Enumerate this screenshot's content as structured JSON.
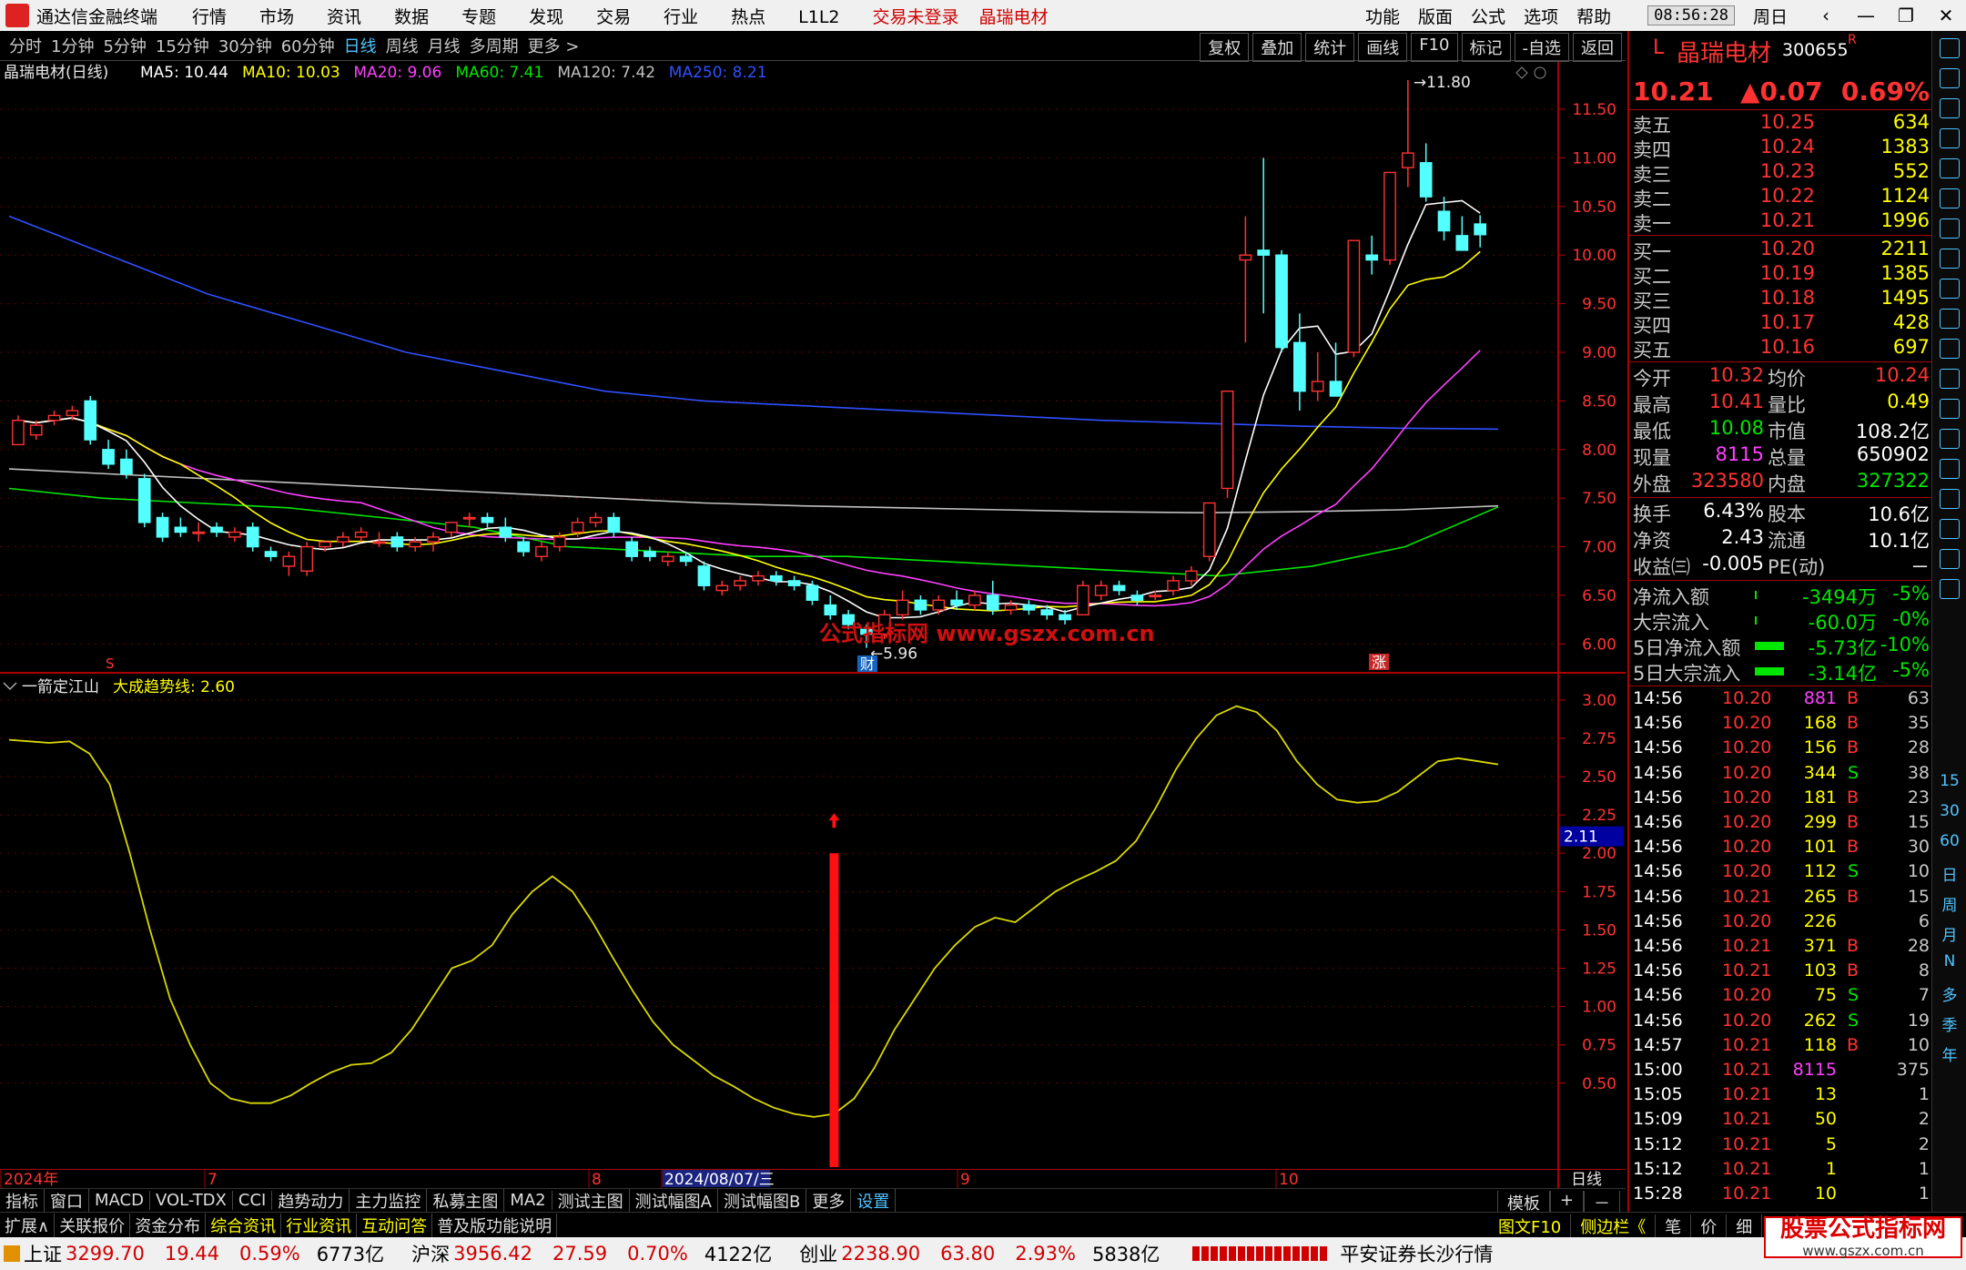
{
  "titlebar": {
    "app_name": "通达信金融终端",
    "menus": [
      "行情",
      "市场",
      "资讯",
      "数据",
      "专题",
      "发现",
      "交易",
      "行业",
      "热点",
      "L1L2"
    ],
    "login_status": "交易未登录",
    "stock_name": "晶瑞电材",
    "right_menus": [
      "功能",
      "版面",
      "公式",
      "选项",
      "帮助"
    ],
    "time": "08:56:28",
    "weekday": "周日"
  },
  "periodbar": {
    "periods": [
      "分时",
      "1分钟",
      "5分钟",
      "15分钟",
      "30分钟",
      "60分钟",
      "日线",
      "周线",
      "月线",
      "多周期",
      "更多 >"
    ],
    "active_index": 6,
    "tools": [
      "复权",
      "叠加",
      "统计",
      "画线",
      "F10",
      "标记",
      "-自选",
      "返回"
    ]
  },
  "main_chart": {
    "stock_title": "晶瑞电材(日线)",
    "ma_labels": [
      {
        "text": "MA5: 10.44",
        "color": "#ffffff"
      },
      {
        "text": "MA10: 10.03",
        "color": "#ffff00"
      },
      {
        "text": "MA20: 9.06",
        "color": "#ff40ff"
      },
      {
        "text": "MA60: 7.41",
        "color": "#00e600"
      },
      {
        "text": "MA120: 7.42",
        "color": "#c0c0c0"
      },
      {
        "text": "MA250: 8.21",
        "color": "#3050ff"
      }
    ],
    "y_ticks": [
      "11.50",
      "11.00",
      "10.50",
      "10.00",
      "9.50",
      "9.00",
      "8.50",
      "8.00",
      "7.50",
      "7.00",
      "6.50",
      "6.00"
    ],
    "high_marker": "11.80",
    "low_marker": "5.96",
    "watermark": "公式指标网  www.gszx.com.cn",
    "mark_cai": "财",
    "mark_zhang": "涨",
    "mark_s": "S"
  },
  "chart_data": {
    "type": "candlestick",
    "y_range": [
      5.9,
      11.8
    ],
    "candles": [
      [
        8.05,
        8.35,
        8.1,
        8.3
      ],
      [
        8.15,
        8.3,
        8.1,
        8.25
      ],
      [
        8.3,
        8.4,
        8.25,
        8.35
      ],
      [
        8.35,
        8.45,
        8.3,
        8.4
      ],
      [
        8.5,
        8.55,
        8.05,
        8.1
      ],
      [
        8.0,
        8.1,
        7.8,
        7.85
      ],
      [
        7.9,
        8.0,
        7.7,
        7.75
      ],
      [
        7.7,
        7.75,
        7.2,
        7.25
      ],
      [
        7.3,
        7.35,
        7.05,
        7.1
      ],
      [
        7.2,
        7.3,
        7.1,
        7.15
      ],
      [
        7.15,
        7.25,
        7.05,
        7.15
      ],
      [
        7.2,
        7.25,
        7.1,
        7.15
      ],
      [
        7.1,
        7.2,
        7.05,
        7.15
      ],
      [
        7.2,
        7.25,
        6.95,
        7.0
      ],
      [
        6.95,
        7.0,
        6.85,
        6.9
      ],
      [
        6.8,
        6.95,
        6.7,
        6.9
      ],
      [
        6.75,
        7.05,
        6.7,
        7.0
      ],
      [
        7.0,
        7.05,
        6.95,
        7.05
      ],
      [
        7.05,
        7.15,
        7.0,
        7.1
      ],
      [
        7.1,
        7.2,
        7.05,
        7.15
      ],
      [
        7.05,
        7.15,
        7.0,
        7.05
      ],
      [
        7.1,
        7.15,
        6.95,
        7.0
      ],
      [
        7.0,
        7.1,
        6.95,
        7.05
      ],
      [
        7.05,
        7.15,
        6.95,
        7.1
      ],
      [
        7.15,
        7.25,
        7.1,
        7.25
      ],
      [
        7.3,
        7.35,
        7.2,
        7.3
      ],
      [
        7.3,
        7.35,
        7.2,
        7.25
      ],
      [
        7.2,
        7.3,
        7.05,
        7.1
      ],
      [
        7.05,
        7.1,
        6.9,
        6.95
      ],
      [
        6.9,
        7.05,
        6.85,
        7.0
      ],
      [
        7.0,
        7.15,
        6.95,
        7.1
      ],
      [
        7.15,
        7.3,
        7.1,
        7.25
      ],
      [
        7.25,
        7.35,
        7.2,
        7.3
      ],
      [
        7.3,
        7.35,
        7.1,
        7.15
      ],
      [
        7.05,
        7.1,
        6.85,
        6.9
      ],
      [
        6.95,
        7.0,
        6.85,
        6.9
      ],
      [
        6.85,
        6.95,
        6.8,
        6.9
      ],
      [
        6.9,
        6.95,
        6.8,
        6.85
      ],
      [
        6.8,
        6.85,
        6.55,
        6.6
      ],
      [
        6.55,
        6.65,
        6.5,
        6.6
      ],
      [
        6.6,
        6.7,
        6.55,
        6.65
      ],
      [
        6.65,
        6.75,
        6.6,
        6.7
      ],
      [
        6.7,
        6.75,
        6.6,
        6.65
      ],
      [
        6.65,
        6.7,
        6.55,
        6.6
      ],
      [
        6.6,
        6.65,
        6.4,
        6.45
      ],
      [
        6.4,
        6.5,
        6.25,
        6.3
      ],
      [
        6.3,
        6.35,
        6.15,
        6.2
      ],
      [
        6.15,
        6.2,
        5.96,
        6.1
      ],
      [
        6.1,
        6.35,
        6.05,
        6.3
      ],
      [
        6.3,
        6.55,
        6.25,
        6.45
      ],
      [
        6.45,
        6.5,
        6.3,
        6.35
      ],
      [
        6.35,
        6.5,
        6.3,
        6.45
      ],
      [
        6.45,
        6.55,
        6.35,
        6.4
      ],
      [
        6.4,
        6.55,
        6.35,
        6.5
      ],
      [
        6.5,
        6.65,
        6.3,
        6.35
      ],
      [
        6.35,
        6.45,
        6.3,
        6.4
      ],
      [
        6.4,
        6.45,
        6.3,
        6.35
      ],
      [
        6.35,
        6.4,
        6.25,
        6.3
      ],
      [
        6.3,
        6.35,
        6.2,
        6.25
      ],
      [
        6.3,
        6.65,
        6.3,
        6.6
      ],
      [
        6.5,
        6.65,
        6.45,
        6.6
      ],
      [
        6.6,
        6.65,
        6.5,
        6.55
      ],
      [
        6.5,
        6.55,
        6.4,
        6.45
      ],
      [
        6.5,
        6.55,
        6.45,
        6.5
      ],
      [
        6.55,
        6.7,
        6.5,
        6.65
      ],
      [
        6.65,
        6.8,
        6.6,
        6.75
      ],
      [
        6.9,
        7.45,
        6.85,
        7.45
      ],
      [
        7.6,
        8.6,
        7.5,
        8.6
      ],
      [
        9.95,
        10.4,
        9.1,
        10.0
      ],
      [
        10.05,
        11.0,
        9.4,
        10.0
      ],
      [
        10.0,
        10.05,
        9.0,
        9.05
      ],
      [
        9.1,
        9.4,
        8.4,
        8.6
      ],
      [
        8.6,
        9.0,
        8.5,
        8.7
      ],
      [
        8.7,
        9.1,
        8.65,
        8.55
      ],
      [
        9.0,
        10.15,
        8.95,
        10.15
      ],
      [
        10.0,
        10.2,
        9.8,
        9.95
      ],
      [
        9.95,
        10.8,
        9.9,
        10.85
      ],
      [
        10.9,
        11.8,
        10.7,
        11.05
      ],
      [
        10.95,
        11.15,
        10.55,
        10.6
      ],
      [
        10.45,
        10.6,
        10.15,
        10.25
      ],
      [
        10.2,
        10.4,
        10.1,
        10.05
      ],
      [
        10.32,
        10.41,
        10.08,
        10.21
      ]
    ],
    "ma_series": [
      {
        "name": "MA5",
        "color": "#ffffff"
      },
      {
        "name": "MA10",
        "color": "#ffff00"
      },
      {
        "name": "MA20",
        "color": "#ff40ff"
      },
      {
        "name": "MA60",
        "color": "#00e600"
      },
      {
        "name": "MA120",
        "color": "#c0c0c0"
      },
      {
        "name": "MA250",
        "color": "#3050ff"
      }
    ],
    "ma120_values": [
      7.8,
      7.75,
      7.7,
      7.65,
      7.6,
      7.55,
      7.5,
      7.45,
      7.42,
      7.4,
      7.38,
      7.36,
      7.35,
      7.36,
      7.38,
      7.42
    ],
    "ma250_values": [
      10.4,
      10.0,
      9.6,
      9.3,
      9.0,
      8.8,
      8.6,
      8.5,
      8.45,
      8.4,
      8.35,
      8.3,
      8.27,
      8.24,
      8.22,
      8.21
    ],
    "ma60_values": [
      7.6,
      7.5,
      7.45,
      7.4,
      7.3,
      7.2,
      7.0,
      6.95,
      6.9,
      6.9,
      6.85,
      6.8,
      6.75,
      6.7,
      6.8,
      7.0,
      7.41
    ],
    "indicator": {
      "name": "一箭定江山",
      "line_name": "大成趋势线",
      "line_value": "2.60",
      "y_ticks": [
        "3.00",
        "2.75",
        "2.50",
        "2.25",
        "2.00",
        "1.75",
        "1.50",
        "1.25",
        "1.00",
        "0.75",
        "0.50"
      ],
      "y_range": [
        0.0,
        3.1
      ],
      "current_marker": "2.11",
      "line_values": [
        2.74,
        2.73,
        2.72,
        2.73,
        2.65,
        2.45,
        2.0,
        1.5,
        1.05,
        0.75,
        0.5,
        0.4,
        0.37,
        0.37,
        0.42,
        0.5,
        0.57,
        0.62,
        0.63,
        0.7,
        0.85,
        1.05,
        1.25,
        1.3,
        1.4,
        1.6,
        1.75,
        1.85,
        1.75,
        1.55,
        1.32,
        1.1,
        0.9,
        0.75,
        0.65,
        0.55,
        0.48,
        0.4,
        0.34,
        0.3,
        0.28,
        0.3,
        0.4,
        0.6,
        0.85,
        1.05,
        1.25,
        1.4,
        1.52,
        1.58,
        1.55,
        1.65,
        1.75,
        1.82,
        1.88,
        1.95,
        2.08,
        2.3,
        2.55,
        2.75,
        2.9,
        2.96,
        2.92,
        2.8,
        2.6,
        2.45,
        2.35,
        2.33,
        2.34,
        2.4,
        2.5,
        2.6,
        2.62,
        2.6,
        2.58
      ],
      "signal_index": 41,
      "signal_value": 2.0
    },
    "x_labels": [
      {
        "text": "2024年"
      },
      {
        "text": "7"
      },
      {
        "text": "8"
      },
      {
        "text": "2024/08/07/三"
      },
      {
        "text": "9"
      },
      {
        "text": "10"
      }
    ],
    "period_label": "日线"
  },
  "quote_panel": {
    "code_prefix": "L",
    "name": "晶瑞电材",
    "code": "300655",
    "r_mark": "R",
    "price": "10.21",
    "change": "▲0.07",
    "change_pct": "0.69%",
    "sells": [
      {
        "label": "卖五",
        "price": "10.25",
        "vol": "634"
      },
      {
        "label": "卖四",
        "price": "10.24",
        "vol": "1383"
      },
      {
        "label": "卖三",
        "price": "10.23",
        "vol": "552"
      },
      {
        "label": "卖二",
        "price": "10.22",
        "vol": "1124"
      },
      {
        "label": "卖一",
        "price": "10.21",
        "vol": "1996"
      }
    ],
    "buys": [
      {
        "label": "买一",
        "price": "10.20",
        "vol": "2211"
      },
      {
        "label": "买二",
        "price": "10.19",
        "vol": "1385"
      },
      {
        "label": "买三",
        "price": "10.18",
        "vol": "1495"
      },
      {
        "label": "买四",
        "price": "10.17",
        "vol": "428"
      },
      {
        "label": "买五",
        "price": "10.16",
        "vol": "697"
      }
    ],
    "stats": [
      {
        "l1": "今开",
        "v1": "10.32",
        "c1": "red",
        "l2": "均价",
        "v2": "10.24",
        "c2": "red"
      },
      {
        "l1": "最高",
        "v1": "10.41",
        "c1": "red",
        "l2": "量比",
        "v2": "0.49",
        "c2": "yellow"
      },
      {
        "l1": "最低",
        "v1": "10.08",
        "c1": "green",
        "l2": "市值",
        "v2": "108.2亿",
        "c2": "white"
      },
      {
        "l1": "现量",
        "v1": "8115",
        "c1": "magenta",
        "l2": "总量",
        "v2": "650902",
        "c2": "white"
      },
      {
        "l1": "外盘",
        "v1": "323580",
        "c1": "red",
        "l2": "内盘",
        "v2": "327322",
        "c2": "green"
      }
    ],
    "stats2": [
      {
        "l1": "换手",
        "v1": "6.43%",
        "l2": "股本",
        "v2": "10.6亿"
      },
      {
        "l1": "净资",
        "v1": "2.43",
        "l2": "流通",
        "v2": "10.1亿"
      },
      {
        "l1": "收益㈢",
        "v1": "-0.005",
        "l2": "PE(动)",
        "v2": "－"
      }
    ],
    "flows": [
      {
        "label": "净流入额",
        "value": "-3494万",
        "pct": "-5%"
      },
      {
        "label": "大宗流入",
        "value": "-60.0万",
        "pct": "-0%"
      },
      {
        "label": "5日净流入额",
        "value": "-5.73亿",
        "pct": "-10%"
      },
      {
        "label": "5日大宗流入",
        "value": "-3.14亿",
        "pct": "-5%"
      }
    ],
    "ticks": [
      {
        "t": "14:56",
        "p": "10.20",
        "v": "881",
        "d": "B",
        "n": "63",
        "vc": "magenta"
      },
      {
        "t": "14:56",
        "p": "10.20",
        "v": "168",
        "d": "B",
        "n": "35",
        "vc": "yellow"
      },
      {
        "t": "14:56",
        "p": "10.20",
        "v": "156",
        "d": "B",
        "n": "28",
        "vc": "yellow"
      },
      {
        "t": "14:56",
        "p": "10.20",
        "v": "344",
        "d": "S",
        "n": "38",
        "vc": "yellow"
      },
      {
        "t": "14:56",
        "p": "10.20",
        "v": "181",
        "d": "B",
        "n": "23",
        "vc": "yellow"
      },
      {
        "t": "14:56",
        "p": "10.20",
        "v": "299",
        "d": "B",
        "n": "15",
        "vc": "yellow"
      },
      {
        "t": "14:56",
        "p": "10.20",
        "v": "101",
        "d": "B",
        "n": "30",
        "vc": "yellow"
      },
      {
        "t": "14:56",
        "p": "10.20",
        "v": "112",
        "d": "S",
        "n": "10",
        "vc": "yellow"
      },
      {
        "t": "14:56",
        "p": "10.21",
        "v": "265",
        "d": "B",
        "n": "15",
        "vc": "yellow"
      },
      {
        "t": "14:56",
        "p": "10.20",
        "v": "226",
        "d": "",
        "n": "6",
        "vc": "yellow"
      },
      {
        "t": "14:56",
        "p": "10.21",
        "v": "371",
        "d": "B",
        "n": "28",
        "vc": "yellow"
      },
      {
        "t": "14:56",
        "p": "10.21",
        "v": "103",
        "d": "B",
        "n": "8",
        "vc": "yellow"
      },
      {
        "t": "14:56",
        "p": "10.20",
        "v": "75",
        "d": "S",
        "n": "7",
        "vc": "yellow"
      },
      {
        "t": "14:56",
        "p": "10.20",
        "v": "262",
        "d": "S",
        "n": "19",
        "vc": "yellow"
      },
      {
        "t": "14:57",
        "p": "10.21",
        "v": "118",
        "d": "B",
        "n": "10",
        "vc": "yellow"
      },
      {
        "t": "15:00",
        "p": "10.21",
        "v": "8115",
        "d": "",
        "n": "375",
        "vc": "magenta"
      },
      {
        "t": "15:05",
        "p": "10.21",
        "v": "13",
        "d": "",
        "n": "1",
        "vc": "yellow"
      },
      {
        "t": "15:09",
        "p": "10.21",
        "v": "50",
        "d": "",
        "n": "2",
        "vc": "yellow"
      },
      {
        "t": "15:12",
        "p": "10.21",
        "v": "5",
        "d": "",
        "n": "2",
        "vc": "yellow"
      },
      {
        "t": "15:12",
        "p": "10.21",
        "v": "1",
        "d": "",
        "n": "1",
        "vc": "yellow"
      },
      {
        "t": "15:28",
        "p": "10.21",
        "v": "10",
        "d": "",
        "n": "1",
        "vc": "yellow"
      }
    ]
  },
  "sidebar_labels": [
    "15",
    "30",
    "60",
    "日",
    "周",
    "月",
    "N",
    "多",
    "季",
    "年"
  ],
  "tabbar1": [
    "指标",
    "窗口",
    "MACD",
    "VOL-TDX",
    "CCI",
    "趋势动力",
    "主力监控",
    "私募主图",
    "MA2",
    "测试主图",
    "测试幅图A",
    "测试幅图B",
    "更多",
    "设置"
  ],
  "tabbar1_right": [
    "模板",
    "+",
    "－"
  ],
  "tabbar2": [
    "扩展∧",
    "关联报价",
    "资金分布",
    "综合资讯",
    "行业资讯",
    "互动问答",
    "普及版功能说明"
  ],
  "tabbar2_right": [
    "图文F10",
    "侧边栏《",
    "笔",
    "价",
    "细",
    "势"
  ],
  "statusbar": {
    "indices": [
      {
        "name": "上证",
        "value": "3299.70",
        "chg": "19.44",
        "pct": "0.59%",
        "amt": "6773亿"
      },
      {
        "name": "沪深",
        "value": "3956.42",
        "chg": "27.59",
        "pct": "0.70%",
        "amt": "4122亿"
      },
      {
        "name": "创业",
        "value": "2238.90",
        "chg": "63.80",
        "pct": "2.93%",
        "amt": "5838亿"
      }
    ],
    "broker": "平安证券长沙行情"
  },
  "brand": {
    "name": "股票公式指标网",
    "url": "www.gszx.com.cn"
  }
}
